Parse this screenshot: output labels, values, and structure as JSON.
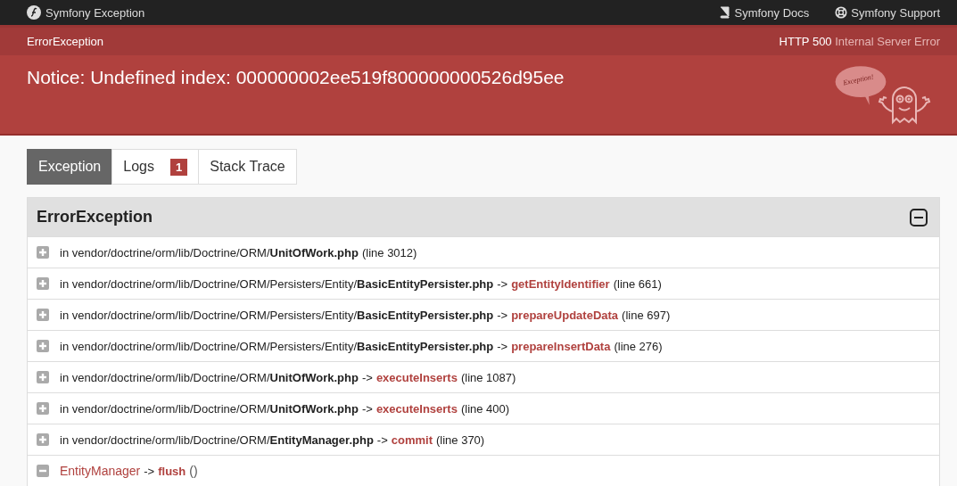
{
  "top_bar": {
    "title": "Symfony Exception",
    "links": [
      {
        "label": "Symfony Docs",
        "kind": "docs"
      },
      {
        "label": "Symfony Support",
        "kind": "support"
      }
    ]
  },
  "sub_header": {
    "exception_class": "ErrorException",
    "status_code": "HTTP 500",
    "status_text": "Internal Server Error"
  },
  "header": {
    "message": "Notice: Undefined index: 000000002ee519f800000000526d95ee",
    "mascot_bubble": "Exception!"
  },
  "tabs": [
    {
      "label": "Exception",
      "selected": true
    },
    {
      "label": "Logs",
      "badge": "1",
      "selected": false
    },
    {
      "label": "Stack Trace",
      "selected": false
    }
  ],
  "panel": {
    "title": "ErrorException",
    "expanded": true,
    "trace": [
      {
        "expanded": false,
        "path": "in vendor/doctrine/orm/lib/Doctrine/ORM/",
        "file": "UnitOfWork.php",
        "line": "(line 3012)"
      },
      {
        "expanded": false,
        "path": "in vendor/doctrine/orm/lib/Doctrine/ORM/Persisters/Entity/",
        "file": "BasicEntityPersister.php",
        "arrow": "->",
        "method": "getEntityIdentifier",
        "line": "(line 661)"
      },
      {
        "expanded": false,
        "path": "in vendor/doctrine/orm/lib/Doctrine/ORM/Persisters/Entity/",
        "file": "BasicEntityPersister.php",
        "arrow": "->",
        "method": "prepareUpdateData",
        "line": "(line 697)"
      },
      {
        "expanded": false,
        "path": "in vendor/doctrine/orm/lib/Doctrine/ORM/Persisters/Entity/",
        "file": "BasicEntityPersister.php",
        "arrow": "->",
        "method": "prepareInsertData",
        "line": "(line 276)"
      },
      {
        "expanded": false,
        "path": "in vendor/doctrine/orm/lib/Doctrine/ORM/",
        "file": "UnitOfWork.php",
        "arrow": "->",
        "method": "executeInserts",
        "line": "(line 1087)"
      },
      {
        "expanded": false,
        "path": "in vendor/doctrine/orm/lib/Doctrine/ORM/",
        "file": "UnitOfWork.php",
        "arrow": "->",
        "method": "executeInserts",
        "line": "(line 400)"
      },
      {
        "expanded": false,
        "path": "in vendor/doctrine/orm/lib/Doctrine/ORM/",
        "file": "EntityManager.php",
        "arrow": "->",
        "method": "commit",
        "line": "(line 370)"
      },
      {
        "expanded": true,
        "class": "EntityManager",
        "arrow": "->",
        "method": "flush",
        "args": "()"
      }
    ]
  }
}
